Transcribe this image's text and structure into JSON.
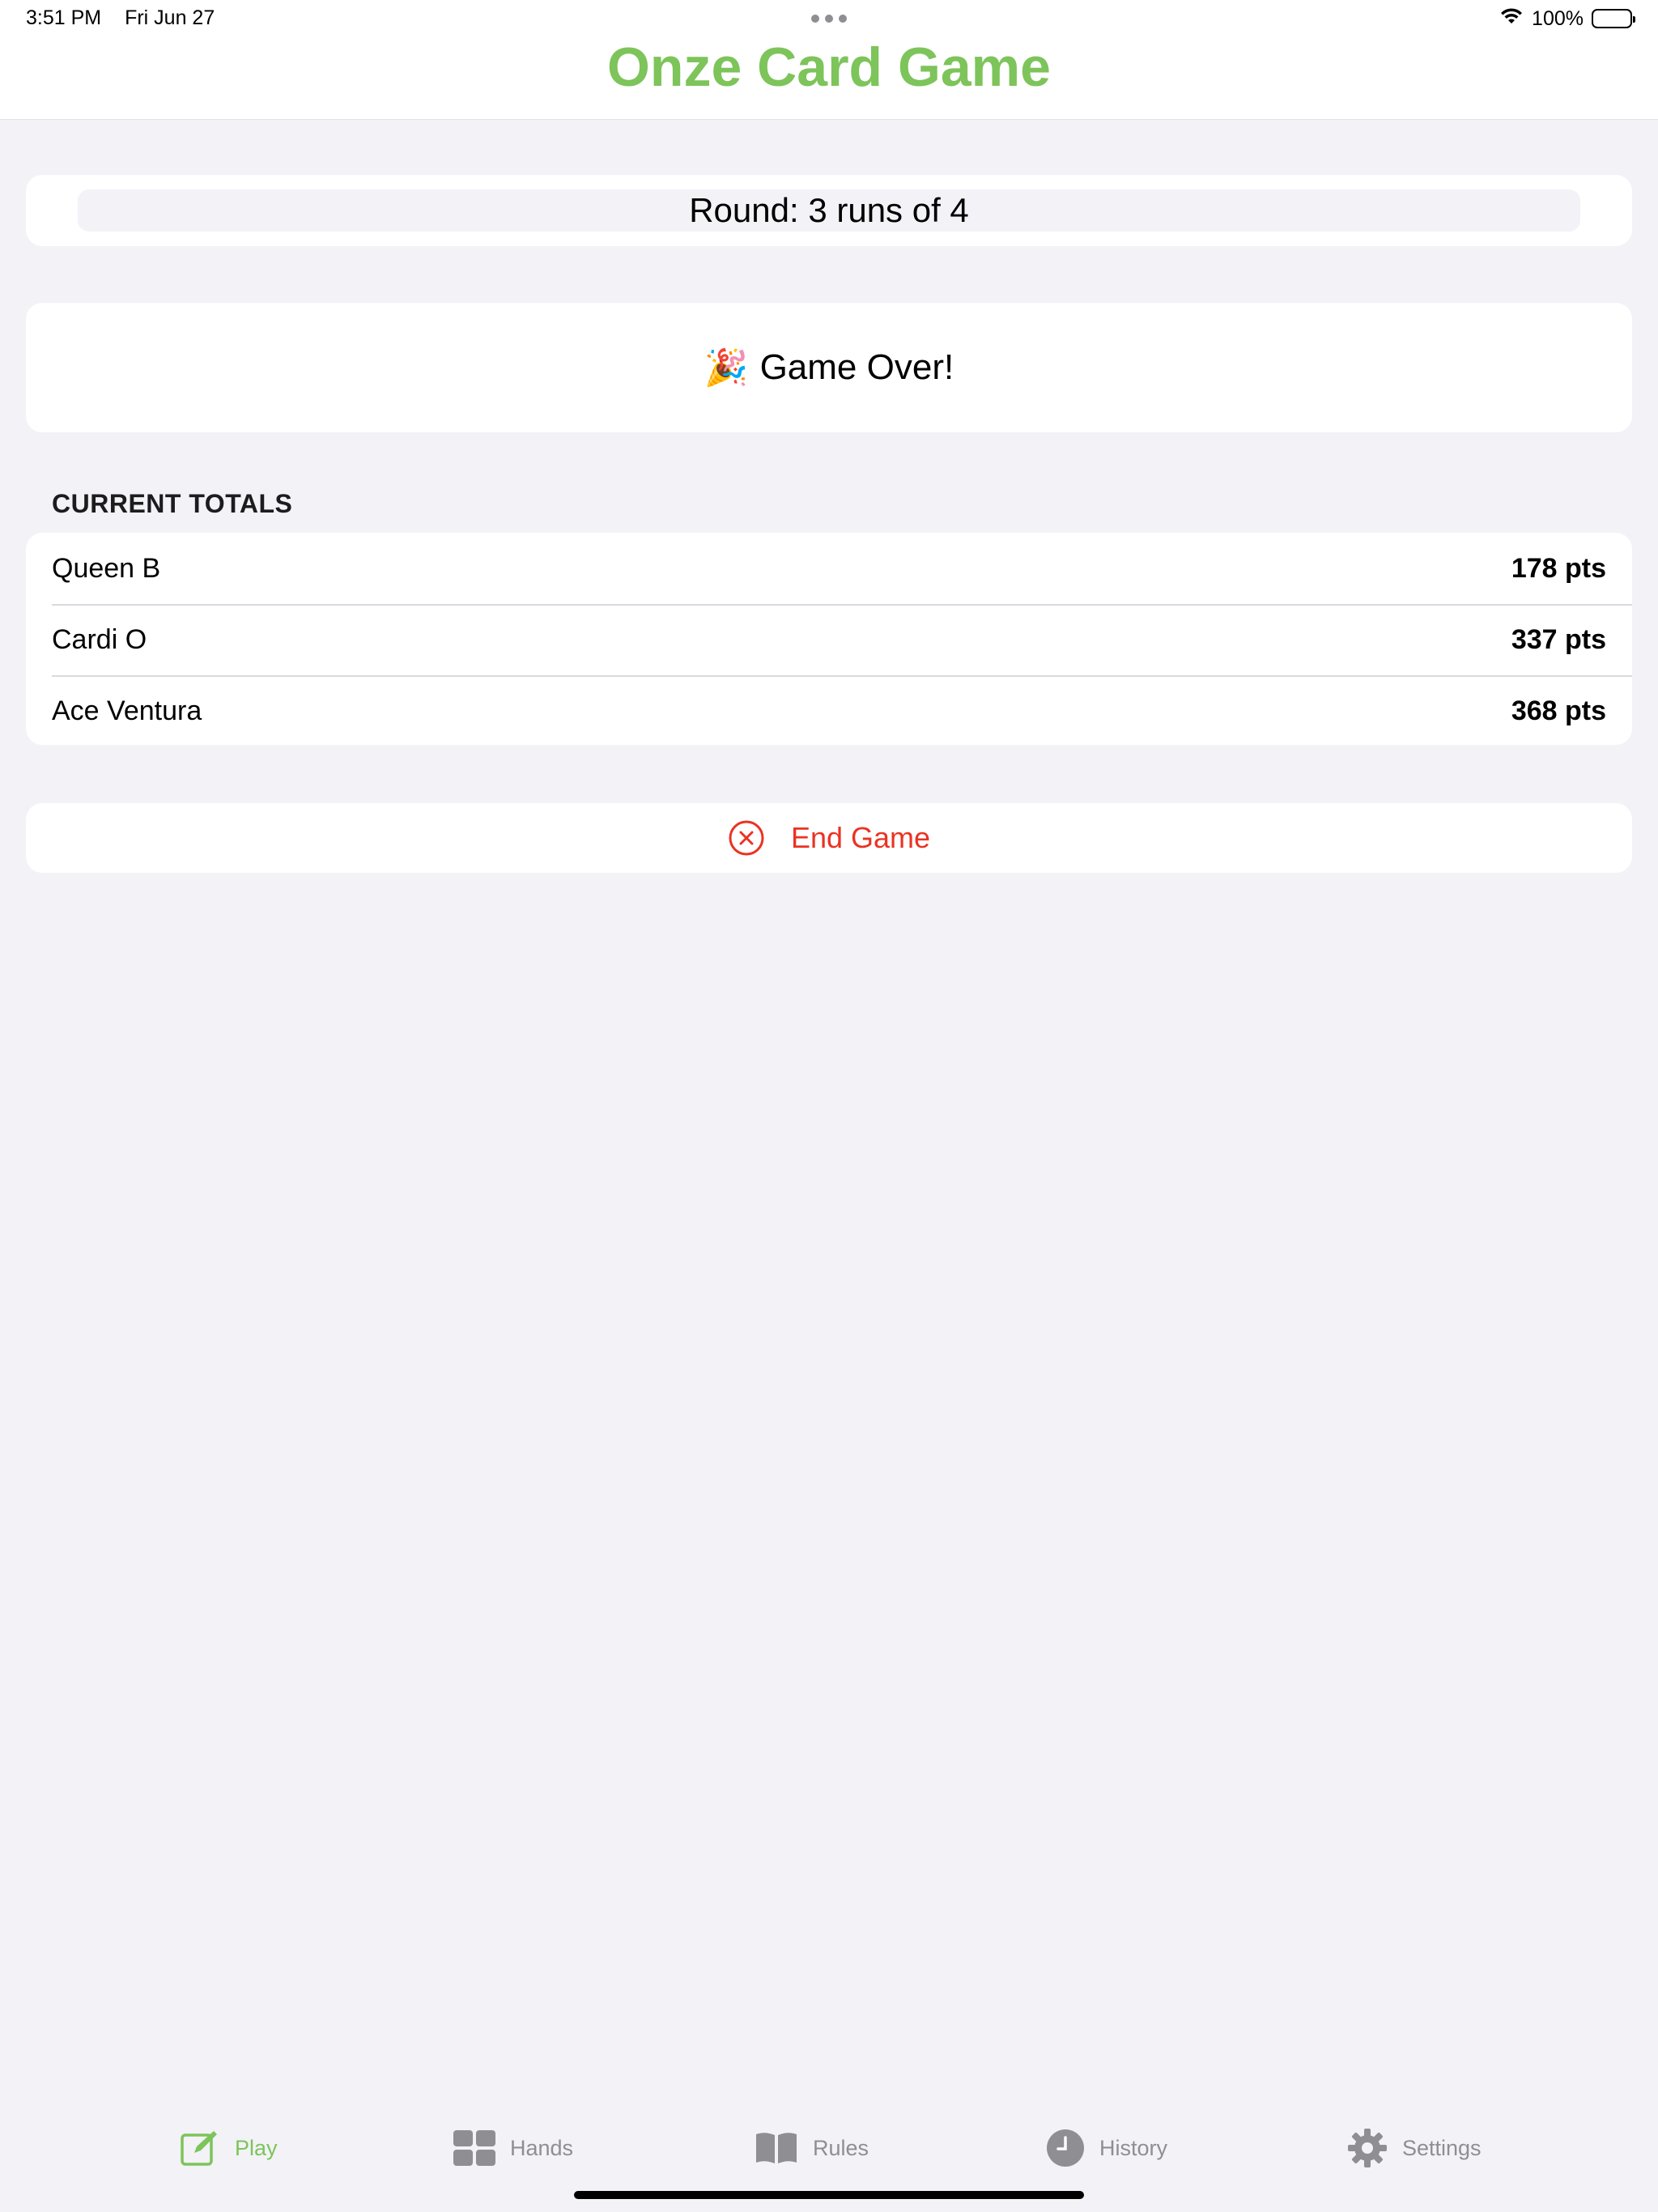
{
  "status_bar": {
    "time": "3:51 PM",
    "date": "Fri Jun 27",
    "battery": "100%"
  },
  "app": {
    "title": "Onze Card Game",
    "accent_color": "#7dc45a",
    "destructive_color": "#ea3323"
  },
  "round": {
    "label": "Round: 3 runs of 4"
  },
  "game_over": {
    "emoji": "🎉",
    "text": "Game Over!"
  },
  "totals": {
    "header": "CURRENT TOTALS",
    "rows": [
      {
        "name": "Queen B",
        "points": "178 pts"
      },
      {
        "name": "Cardi O",
        "points": "337 pts"
      },
      {
        "name": "Ace Ventura",
        "points": "368 pts"
      }
    ]
  },
  "end_game": {
    "label": "End Game",
    "icon": "x-circle-icon"
  },
  "tabs": [
    {
      "label": "Play",
      "icon": "square-pencil-icon",
      "active": true
    },
    {
      "label": "Hands",
      "icon": "grid-icon",
      "active": false
    },
    {
      "label": "Rules",
      "icon": "book-icon",
      "active": false
    },
    {
      "label": "History",
      "icon": "clock-icon",
      "active": false
    },
    {
      "label": "Settings",
      "icon": "gear-icon",
      "active": false
    }
  ]
}
